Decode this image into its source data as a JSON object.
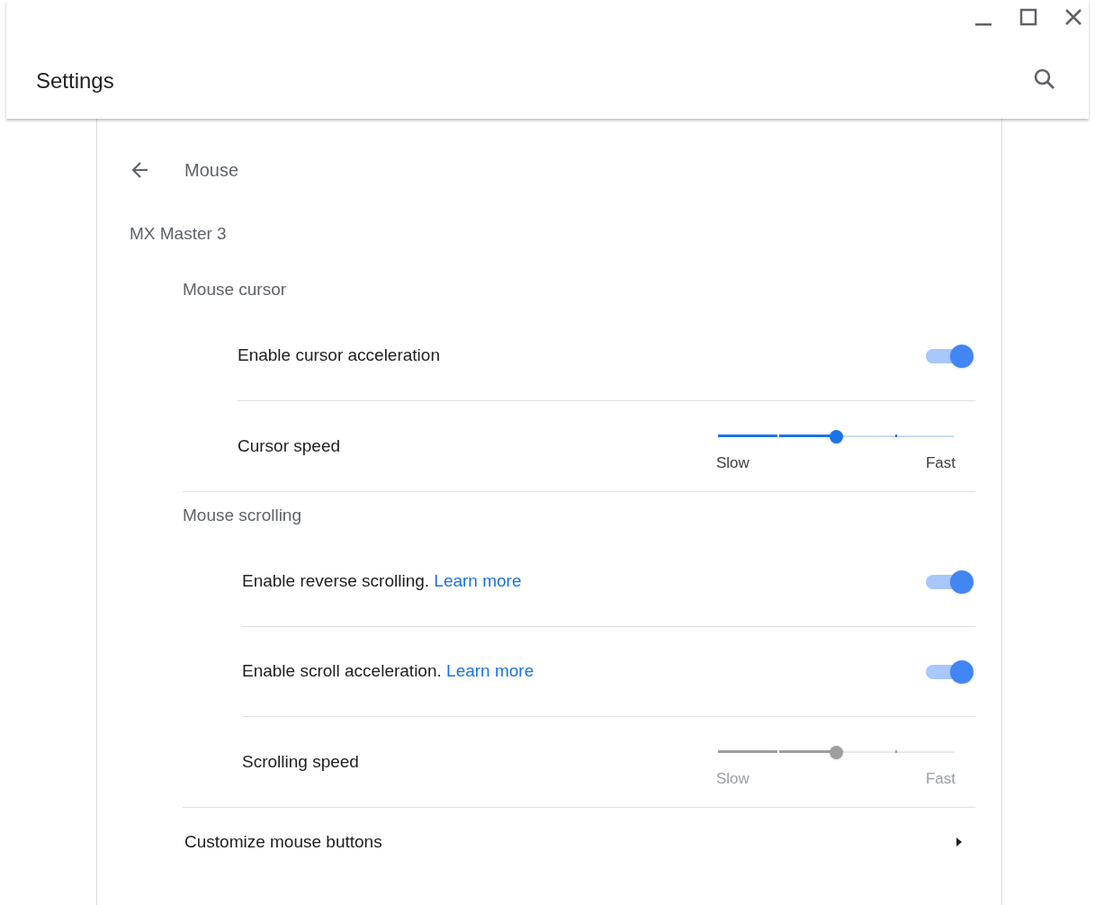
{
  "window": {
    "title": "Settings"
  },
  "page": {
    "title": "Mouse"
  },
  "device": "MX Master 3",
  "sections": [
    {
      "title": "Mouse cursor",
      "rows": [
        {
          "kind": "toggle",
          "label": "Enable cursor acceleration",
          "on": true
        },
        {
          "kind": "slider",
          "label": "Cursor speed",
          "level": 0.5,
          "disabled": false,
          "min_label": "Slow",
          "max_label": "Fast"
        }
      ]
    },
    {
      "title": "Mouse scrolling",
      "rows": [
        {
          "kind": "toggle",
          "label": "Enable reverse scrolling.",
          "link": "Learn more",
          "on": true
        },
        {
          "kind": "toggle",
          "label": "Enable scroll acceleration.",
          "link": "Learn more",
          "on": true
        },
        {
          "kind": "slider",
          "label": "Scrolling speed",
          "level": 0.5,
          "disabled": true,
          "min_label": "Slow",
          "max_label": "Fast"
        }
      ]
    }
  ],
  "footer_row": {
    "label": "Customize mouse buttons"
  }
}
